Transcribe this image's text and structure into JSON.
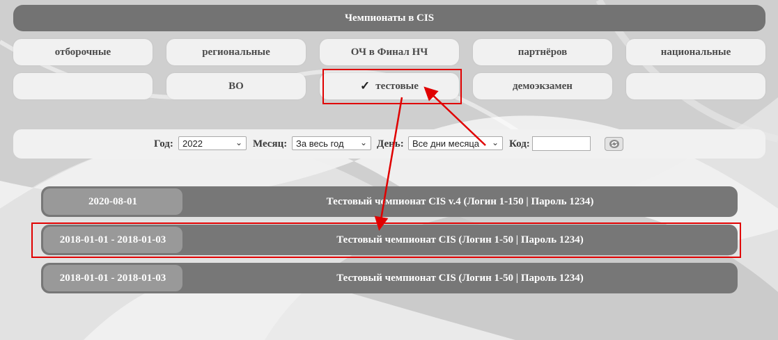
{
  "header": {
    "title": "Чемпионаты в CIS"
  },
  "categories": {
    "row1": [
      "отборочные",
      "региональные",
      "ОЧ в Финал НЧ",
      "партнёров",
      "национальные"
    ],
    "row2": [
      "",
      "ВО",
      "тестовые",
      "демоэкзамен",
      ""
    ],
    "selected_mark": "✓"
  },
  "filters": {
    "year_label": "Год:",
    "year_value": "2022",
    "month_label": "Месяц:",
    "month_value": "За весь год",
    "day_label": "День:",
    "day_value": "Все дни месяца",
    "code_label": "Код:",
    "code_value": ""
  },
  "championships": [
    {
      "date": "2020-08-01",
      "title": "Тестовый чемпионат CIS v.4 (Логин 1-150 | Пароль 1234)"
    },
    {
      "date": "2018-01-01 - 2018-01-03",
      "title": "Тестовый чемпионат CIS (Логин 1-50 | Пароль 1234)"
    },
    {
      "date": "2018-01-01 - 2018-01-03",
      "title": "Тестовый чемпионат CIS (Логин 1-50 | Пароль 1234)"
    }
  ],
  "colors": {
    "annotation": "#e00000",
    "row_bg": "#777777",
    "pill_bg": "#999999",
    "button_bg": "#f1f1f1"
  },
  "icons": {
    "refresh": "refresh-icon",
    "dropdown": "chevron-down-icon"
  }
}
